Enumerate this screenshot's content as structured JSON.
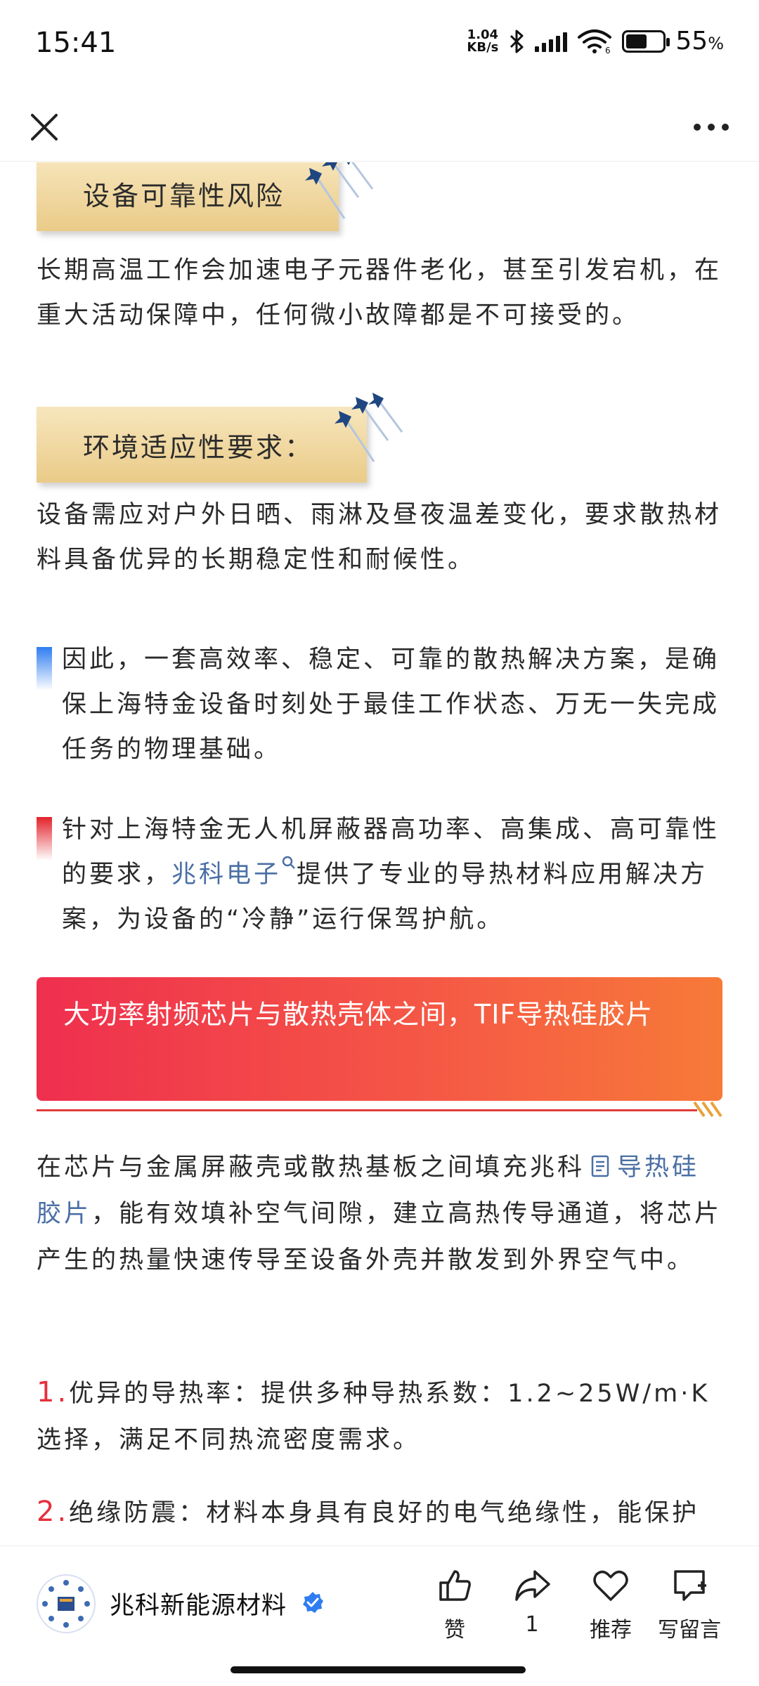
{
  "status_bar": {
    "time": "15:41",
    "net_speed_value": "1.04",
    "net_speed_unit": "KB/s",
    "battery_percent": "55",
    "battery_unit": "%",
    "battery_level": 0.55
  },
  "nav": {
    "close_icon": "close-icon",
    "more_icon": "more-icon"
  },
  "article": {
    "section1": {
      "heading": "设备可靠性风险",
      "body": "长期高温工作会加速电子元器件老化，甚至引发宕机，在重大活动保障中，任何微小故障都是不可接受的。"
    },
    "section2": {
      "heading": "环境适应性要求：",
      "body": "设备需应对户外日晒、雨淋及昼夜温差变化，要求散热材料具备优异的长期稳定性和耐候性。"
    },
    "quote1": "因此，一套高效率、稳定、可靠的散热解决方案，是确保上海特金设备时刻处于最佳工作状态、万无一失完成任务的物理基础。",
    "quote2": {
      "before": "针对上海特金无人机屏蔽器高功率、高集成、高可靠性的要求，",
      "link": "兆科电子",
      "after": "提供了专业的导热材料应用解决方案，为设备的“冷静”运行保驾护航。"
    },
    "red_banner": "大功率射频芯片与散热壳体之间，TIF导热硅胶片",
    "para3": {
      "before": "在芯片与金属屏蔽壳或散热基板之间填充兆科",
      "link": "导热硅胶片",
      "after": "，能有效填补空气间隙，建立高热传导通道，将芯片产生的热量快速传导至设备外壳并散发到外界空气中。"
    },
    "item1": {
      "num": "1.",
      "text": "优异的导热率：提供多种导热系数：1.2~25W/m·K选择，满足不同热流密度需求。"
    },
    "item2": {
      "num": "2.",
      "text": "绝缘防震：材料本身具有良好的电气绝缘性，能保护"
    }
  },
  "bottom_bar": {
    "account_name": "兆科新能源材料",
    "actions": [
      {
        "icon": "thumbs-up-icon",
        "label": "赞"
      },
      {
        "icon": "share-icon",
        "label": "1"
      },
      {
        "icon": "heart-icon",
        "label": "推荐"
      },
      {
        "icon": "comment-icon",
        "label": "写留言"
      }
    ]
  },
  "colors": {
    "accent_red": "#ef2f4e",
    "link_blue": "#4a6fa5",
    "banner_gold": "#eacb88"
  }
}
